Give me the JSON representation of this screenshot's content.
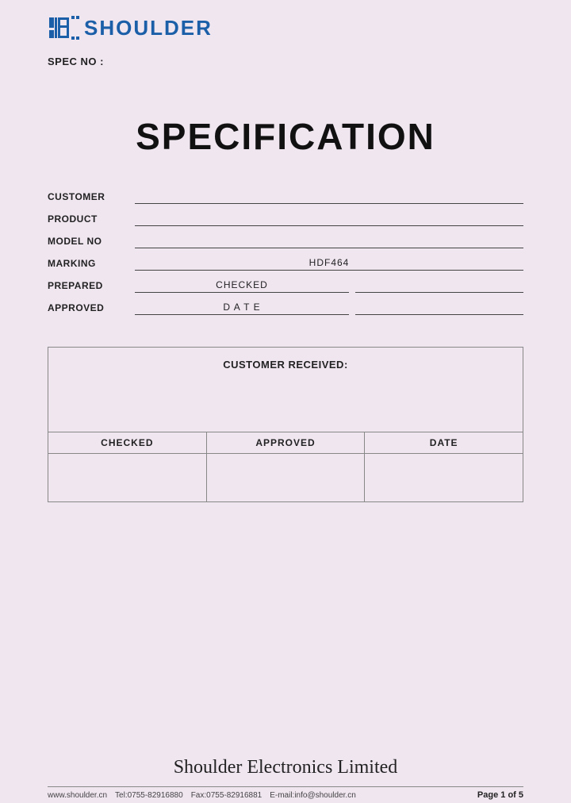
{
  "logo": {
    "text": "SHOULDER"
  },
  "spec_no_label": "SPEC NO :",
  "main_title": "SPECIFICATION",
  "fields": [
    {
      "label": "CUSTOMER",
      "value": ""
    },
    {
      "label": "PRODUCT",
      "value": ""
    },
    {
      "label": "MODEL NO",
      "value": ""
    },
    {
      "label": "MARKING",
      "value": "HDF464"
    },
    {
      "label": "PREPARED",
      "value": "CHECKED"
    },
    {
      "label": "APPROVED",
      "value": "D A T E"
    }
  ],
  "customer_received_label": "CUSTOMER RECEIVED:",
  "table_headers": [
    "CHECKED",
    "APPROVED",
    "DATE"
  ],
  "company_name": "Shoulder Electronics Limited",
  "footer": {
    "website": "www.shoulder.cn",
    "tel": "Tel:0755-82916880",
    "fax": "Fax:0755-82916881",
    "email": "E-mail:info@shoulder.cn",
    "page": "Page 1 of 5"
  }
}
